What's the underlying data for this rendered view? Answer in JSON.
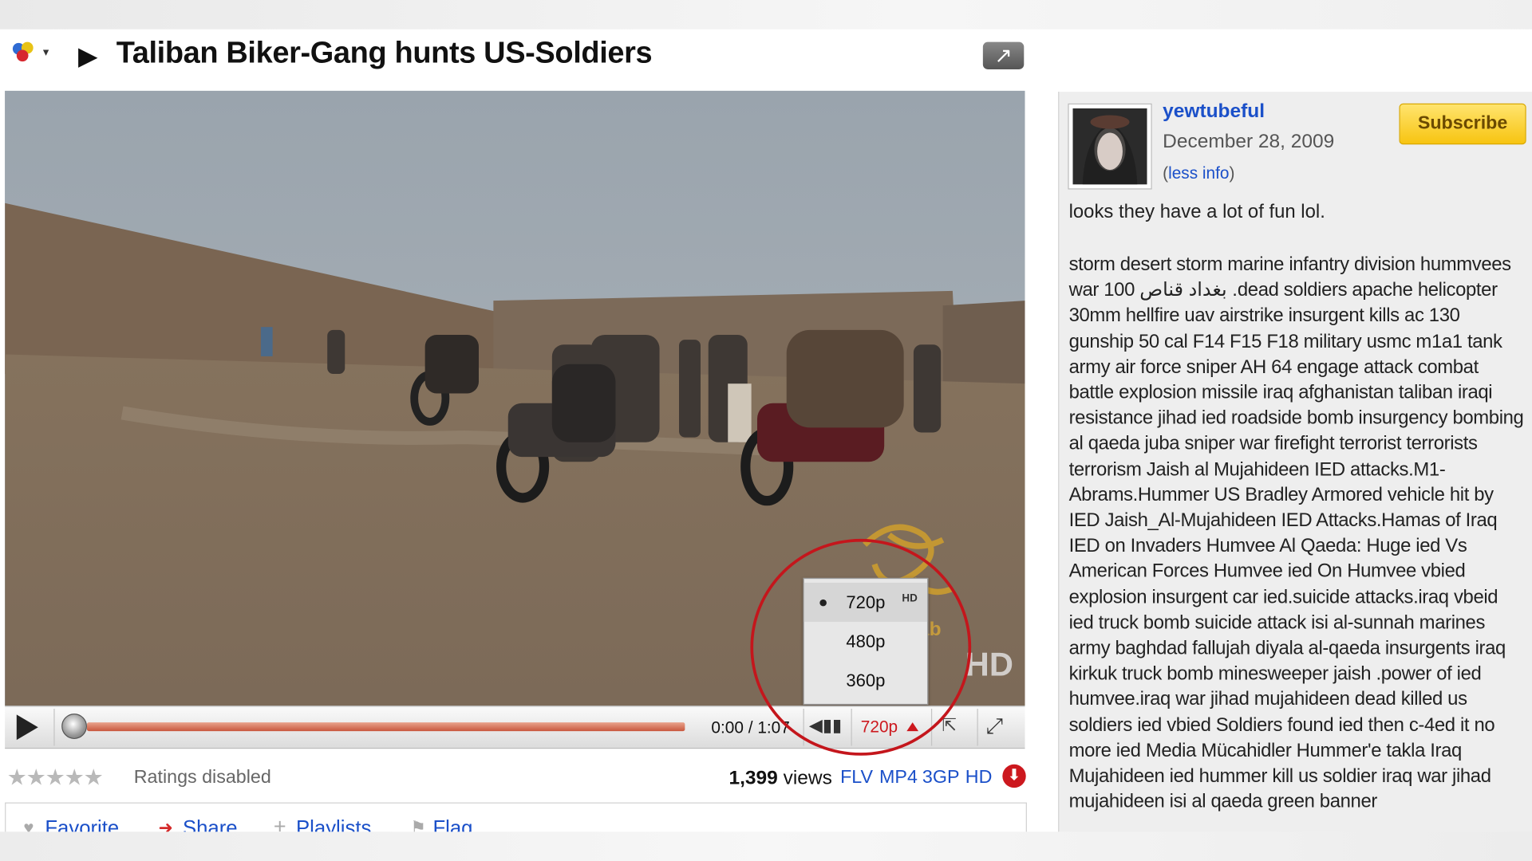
{
  "video": {
    "title": "Taliban Biker-Gang hunts US-Soldiers",
    "watermark_text": "ab",
    "watermark_hd": "HD",
    "current_time": "0:00",
    "duration": "1:07",
    "time_separator": " / ",
    "progress": 0.0,
    "quality_label": "720p",
    "quality_menu": [
      {
        "label": "720p",
        "badge": "HD",
        "selected": true
      },
      {
        "label": "480p",
        "selected": false
      },
      {
        "label": "360p",
        "selected": false
      }
    ]
  },
  "ratings": {
    "stars": "★★★★★",
    "text": "Ratings disabled"
  },
  "stats": {
    "views_count": "1,399",
    "views_label": " views",
    "formats": [
      "FLV",
      "MP4",
      "3GP",
      "HD"
    ]
  },
  "actions": [
    {
      "icon": "heart-icon",
      "glyph": "♥",
      "label": "Favorite"
    },
    {
      "icon": "share-arrow-icon",
      "glyph": "➜",
      "label": "Share"
    },
    {
      "icon": "plus-icon",
      "glyph": "+",
      "label": "Playlists"
    },
    {
      "icon": "flag-icon",
      "glyph": "⚑",
      "label": "Flag"
    }
  ],
  "uploader": {
    "name": "yewtubeful",
    "date": "December 28, 2009",
    "less_info_prefix": "(",
    "less_info": "less info",
    "less_info_suffix": ")",
    "subscribe_label": "Subscribe"
  },
  "description": {
    "line1": "looks they have a lot of fun lol.",
    "tags": "storm desert storm marine infantry division hummvees war 100 بغداد قناص .dead soldiers apache helicopter 30mm hellfire uav airstrike insurgent kills ac 130 gunship 50 cal F14 F15 F18 military usmc m1a1 tank army air force sniper AH 64 engage attack combat battle explosion missile iraq afghanistan taliban iraqi resistance jihad ied roadside bomb insurgency bombing al qaeda juba sniper war firefight terrorist terrorists terrorism Jaish al Mujahideen IED attacks.M1-Abrams.Hummer US Bradley Armored vehicle hit by IED Jaish_Al-Mujahideen IED Attacks.Hamas of Iraq IED on Invaders Humvee Al Qaeda: Huge ied Vs American Forces Humvee ied On Humvee vbied explosion insurgent car ied.suicide attacks.iraq vbeid ied truck bomb suicide attack isi al-sunnah marines army baghdad fallujah diyala al-qaeda insurgents iraq kirkuk truck bomb minesweeper jaish .power of ied humvee.iraq war jihad mujahideen dead killed us soldiers ied vbied Soldiers found ied then c-4ed it no more ied Media Mücahidler Hummer'e takla Iraq Mujahideen ied hummer kill us soldier iraq war jihad mujahideen isi al qaeda green banner"
  },
  "colors": {
    "link": "#1b50c9",
    "annotation_circle": "#c4161c",
    "subscribe": "#f7c411",
    "progress": "#c8563d"
  }
}
